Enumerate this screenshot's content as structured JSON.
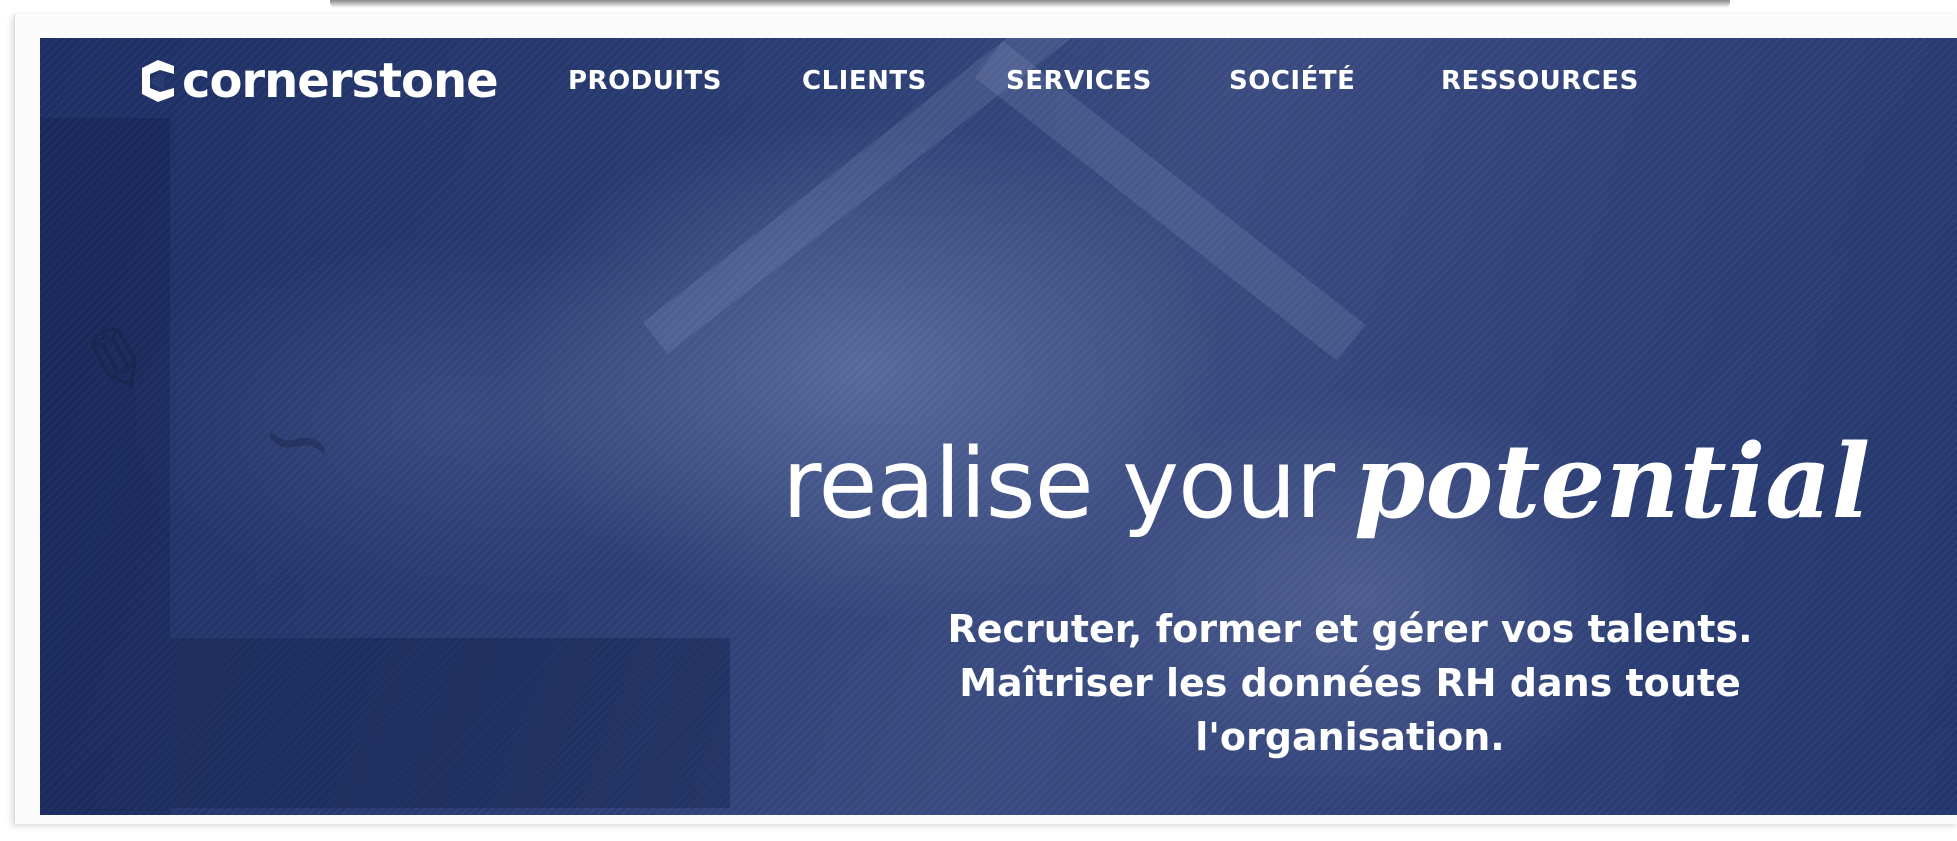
{
  "brand": {
    "logo_text": "cornerstone",
    "logo_icon": "cornerstone-c-mark-icon"
  },
  "nav": {
    "items": [
      {
        "label": "PRODUITS"
      },
      {
        "label": "CLIENTS"
      },
      {
        "label": "SERVICES"
      },
      {
        "label": "SOCIÉTÉ"
      },
      {
        "label": "RESSOURCES"
      }
    ]
  },
  "hero": {
    "headline_plain": "realise your",
    "headline_script": "potential",
    "subtext_lines": [
      "Recruter, former et gérer vos talents.",
      "Maîtriser les données RH dans toute",
      "l'organisation."
    ]
  },
  "colors": {
    "hero_background": "#2a3d72",
    "text": "#ffffff"
  }
}
